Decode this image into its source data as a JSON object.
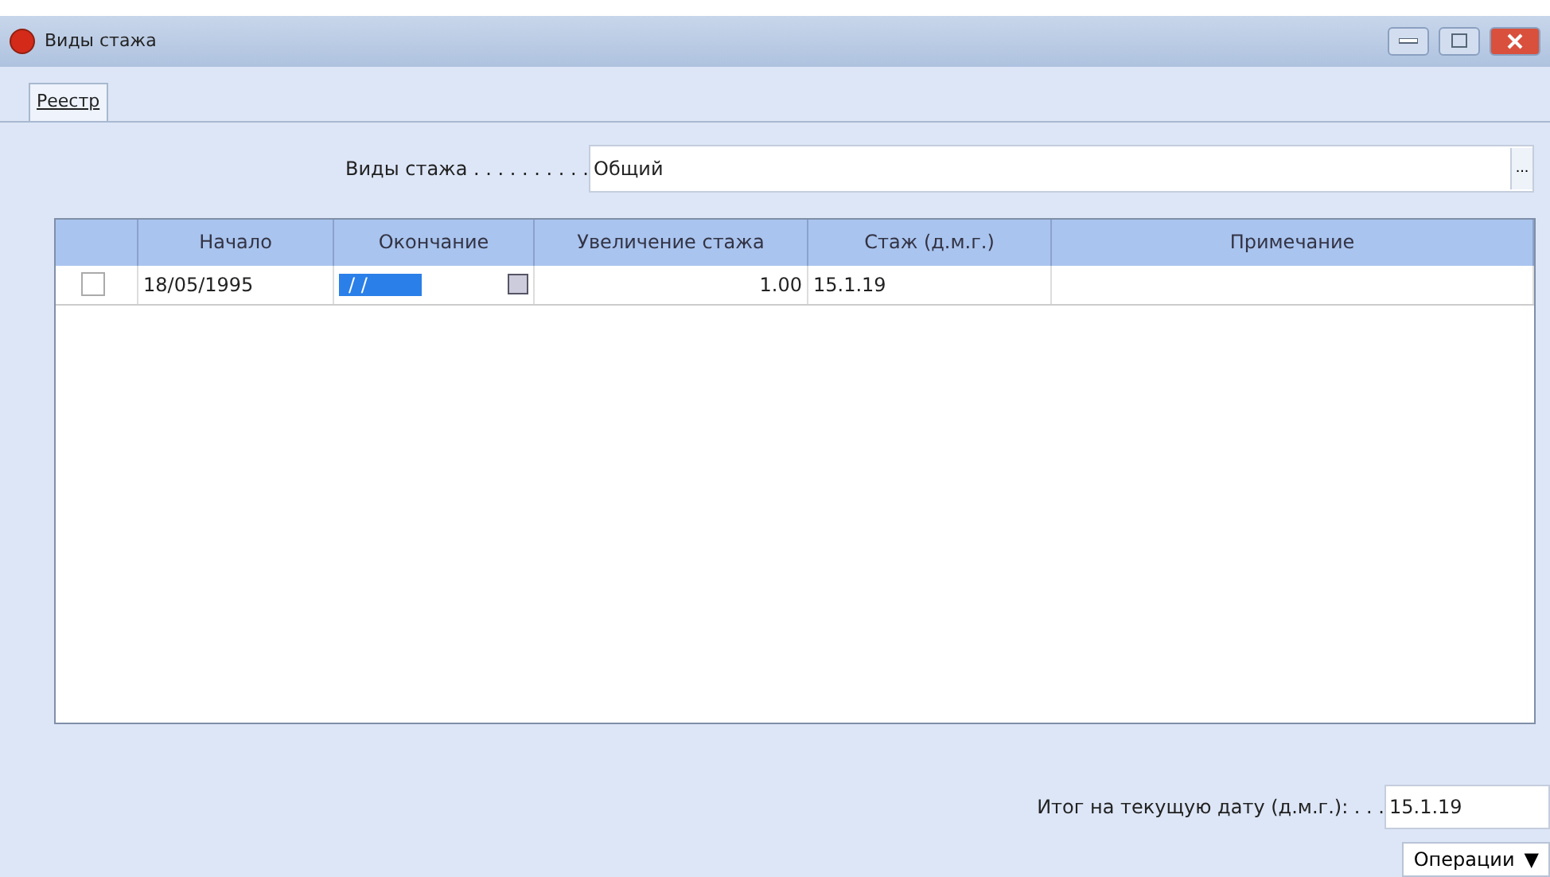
{
  "window": {
    "title": "Виды стажа"
  },
  "tabs": [
    {
      "label": "Реестр",
      "selected": true
    }
  ],
  "field": {
    "label": "Виды стажа . . . . . . . . . .",
    "value": "Общий",
    "button": "..."
  },
  "table": {
    "columns": [
      "",
      "Начало",
      "Окончание",
      "Увеличение стажа",
      "Стаж (д.м.г.)",
      "Примечание"
    ],
    "rows": [
      {
        "checked": false,
        "start": "18/05/1995",
        "end": "/ /",
        "increase": "1.00",
        "tenure": "15.1.19",
        "note": ""
      }
    ]
  },
  "total": {
    "label": "Итог на текущую дату (д.м.г.): . . .",
    "value": "15.1.19"
  },
  "operations": {
    "label": "Операции",
    "caret": "▼"
  }
}
